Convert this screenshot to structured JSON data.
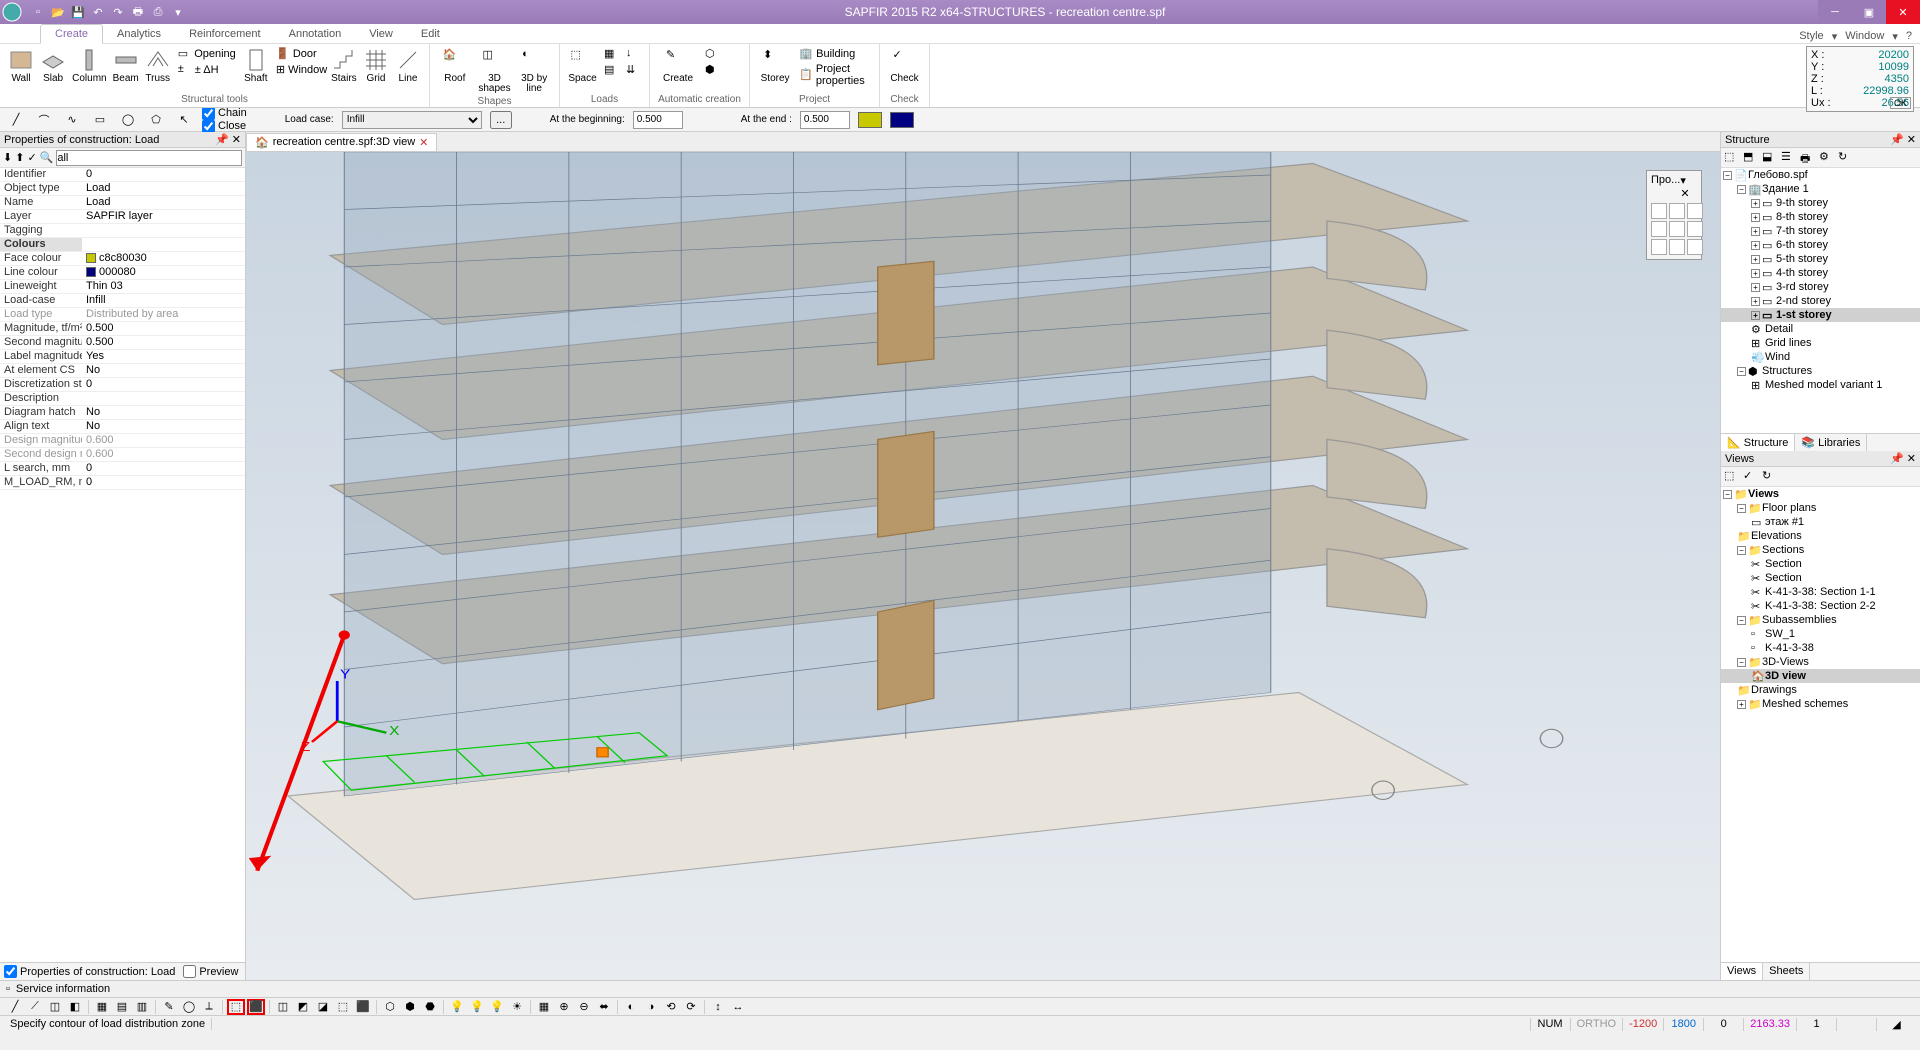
{
  "app": {
    "title": "SAPFIR 2015 R2 x64-STRUCTURES - recreation centre.spf"
  },
  "ribbon_tabs": [
    "Create",
    "Analytics",
    "Reinforcement",
    "Annotation",
    "View",
    "Edit"
  ],
  "ribbon_right": [
    "Style",
    "Window",
    "?"
  ],
  "ribbon": {
    "structural_tools": {
      "label": "Structural tools",
      "wall": "Wall",
      "slab": "Slab",
      "column": "Column",
      "beam": "Beam",
      "truss": "Truss",
      "opening": "Opening",
      "door": "Door",
      "dh": "± ΔH",
      "shaft": "Shaft",
      "window": "Window",
      "stairs": "Stairs",
      "grid": "Grid",
      "line": "Line"
    },
    "shapes": {
      "label": "Shapes",
      "roof": "Roof",
      "shapes3d": "3D shapes",
      "by_line": "3D by line"
    },
    "loads": {
      "label": "Loads",
      "space": "Space"
    },
    "auto": {
      "label": "Automatic creation",
      "create": "Create"
    },
    "project": {
      "label": "Project",
      "storey": "Storey",
      "building": "Building",
      "pp": "Project properties"
    },
    "check": {
      "label": "Check",
      "check": "Check"
    }
  },
  "coords": {
    "x": "20200",
    "y": "10099",
    "z": "4350",
    "l": "22998.96",
    "ux": "26.56",
    "ok": "OK"
  },
  "opts": {
    "chain": "Chain",
    "close": "Close",
    "loadcase_lbl": "Load case:",
    "loadcase_val": "Infill",
    "begin_lbl": "At the beginning:",
    "begin_val": "0.500",
    "end_lbl": "At the end :",
    "end_val": "0.500"
  },
  "props": {
    "title": "Properties of construction: Load",
    "filter": "all",
    "rows": [
      {
        "k": "Identifier",
        "v": "0"
      },
      {
        "k": "Object type",
        "v": "Load"
      },
      {
        "k": "Name",
        "v": "Load"
      },
      {
        "k": "Layer",
        "v": "SAPFIR layer"
      },
      {
        "k": "Tagging",
        "v": ""
      },
      {
        "k": "Colours",
        "v": "",
        "grp": true
      },
      {
        "k": "Face colour",
        "v": "c8c80030",
        "sw": "#c8c800"
      },
      {
        "k": "Line colour",
        "v": "000080",
        "sw": "#000080"
      },
      {
        "k": "Lineweight",
        "v": "Thin 03"
      },
      {
        "k": "Load-case",
        "v": "Infill"
      },
      {
        "k": "Load type",
        "v": "Distributed by area",
        "dim": true
      },
      {
        "k": "Magnitude, tf/m²",
        "v": "0.500"
      },
      {
        "k": "Second magnitud...",
        "v": "0.500"
      },
      {
        "k": "Label magnitudes",
        "v": "Yes"
      },
      {
        "k": "At element CS",
        "v": "No"
      },
      {
        "k": "Discretization ste...",
        "v": "0"
      },
      {
        "k": "Description",
        "v": ""
      },
      {
        "k": "Diagram hatch",
        "v": "No"
      },
      {
        "k": "Align text",
        "v": "No"
      },
      {
        "k": "Design magnitud...",
        "v": "0.600",
        "dim": true
      },
      {
        "k": "Second design m...",
        "v": "0.600",
        "dim": true
      },
      {
        "k": "L search, mm",
        "v": "0"
      },
      {
        "k": "M_LOAD_RM, mm",
        "v": "0"
      }
    ],
    "footer_props": "Properties of construction: Load",
    "footer_preview": "Preview"
  },
  "doc_tab": "recreation centre.spf:3D view",
  "view_float_title": "Про...",
  "structure": {
    "title": "Structure",
    "root": "Глебово.spf",
    "building": "Здание 1",
    "storeys": [
      "9-th storey",
      "8-th storey",
      "7-th storey",
      "6-th storey",
      "5-th storey",
      "4-th storey",
      "3-rd storey",
      "2-nd storey",
      "1-st storey"
    ],
    "detail": "Detail",
    "gridlines": "Grid lines",
    "wind": "Wind",
    "structures": "Structures",
    "meshed": "Meshed model variant 1",
    "tab_structure": "Structure",
    "tab_libraries": "Libraries"
  },
  "views": {
    "title": "Views",
    "root": "Views",
    "floorplans": "Floor plans",
    "etazh": "этаж #1",
    "elevations": "Elevations",
    "sections": "Sections",
    "section_items": [
      "Section",
      "Section",
      "K-41-3-38: Section 1-1",
      "K-41-3-38: Section 2-2"
    ],
    "subassemblies": "Subassemblies",
    "sw1": "SW_1",
    "k41": "K-41-3-38",
    "views3d": "3D-Views",
    "view3d": "3D view",
    "drawings": "Drawings",
    "meshed": "Meshed schemes",
    "tab_views": "Views",
    "tab_sheets": "Sheets"
  },
  "service_info": "Service information",
  "status": {
    "hint": "Specify contour of load distribution zone",
    "num": "NUM",
    "ortho": "ORTHO",
    "c1": "-1200",
    "c2": "1800",
    "c3": "0",
    "c4": "2163.33",
    "c5": "1",
    "c6": ""
  }
}
